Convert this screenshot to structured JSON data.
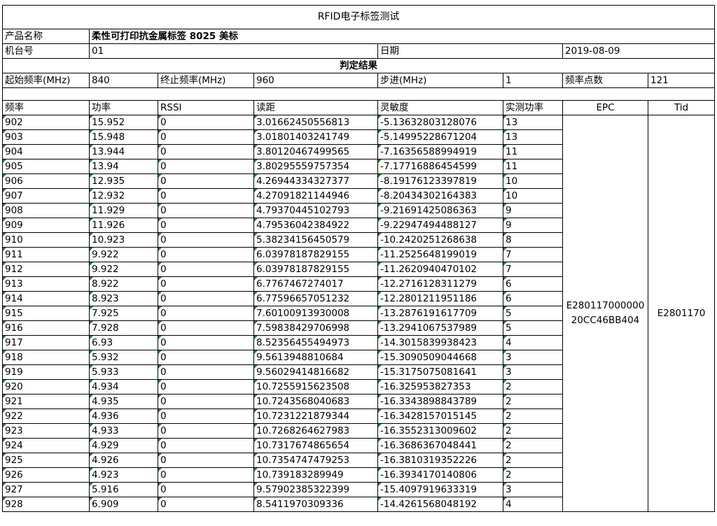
{
  "title": "RFID电子标签测试",
  "product": {
    "label": "产品名称",
    "value": "柔性可打印抗金属标签 8025 美标"
  },
  "machine": {
    "label": "机台号",
    "value": "01",
    "date_label": "日期",
    "date_value": "2019-08-09"
  },
  "judgement": "判定结果",
  "params": {
    "start_label": "起始频率(MHz)",
    "start_value": "840",
    "end_label": "终止频率(MHz)",
    "end_value": "960",
    "step_label": "步进(MHz)",
    "step_value": "1",
    "points_label": "频率点数",
    "points_value": "121"
  },
  "columns": [
    "频率",
    "功率",
    "RSSI",
    "读距",
    "灵敏度",
    "实测功率",
    "EPC",
    "Tid"
  ],
  "epc": "E280117000000 20CC46BB404",
  "tid": "E2801170",
  "rows": [
    [
      "902",
      "15.952",
      "0",
      "3.01662450556813",
      "-5.13632803128076",
      "13"
    ],
    [
      "903",
      "15.948",
      "0",
      "3.01801403241749",
      "-5.14995228671204",
      "13"
    ],
    [
      "904",
      "13.944",
      "0",
      "3.80120467499565",
      "-7.16356588994919",
      "11"
    ],
    [
      "905",
      "13.94",
      "0",
      "3.80295559757354",
      "-7.17716886454599",
      "11"
    ],
    [
      "906",
      "12.935",
      "0",
      "4.26944334327377",
      "-8.19176123397819",
      "10"
    ],
    [
      "907",
      "12.932",
      "0",
      "4.27091821144946",
      "-8.20434302164383",
      "10"
    ],
    [
      "908",
      "11.929",
      "0",
      "4.79370445102793",
      "-9.21691425086363",
      "9"
    ],
    [
      "909",
      "11.926",
      "0",
      "4.79536042384922",
      "-9.22947494488127",
      "9"
    ],
    [
      "910",
      "10.923",
      "0",
      "5.38234156450579",
      "-10.2420251268638",
      "8"
    ],
    [
      "911",
      "9.922",
      "0",
      "6.03978187829155",
      "-11.2525648199019",
      "7"
    ],
    [
      "912",
      "9.922",
      "0",
      "6.03978187829155",
      "-11.2620940470102",
      "7"
    ],
    [
      "913",
      "8.922",
      "0",
      "6.7767467274017",
      "-12.2716128311279",
      "6"
    ],
    [
      "914",
      "8.923",
      "0",
      "6.77596657051232",
      "-12.2801211951186",
      "6"
    ],
    [
      "915",
      "7.925",
      "0",
      "7.60100913930008",
      "-13.2876191617709",
      "5"
    ],
    [
      "916",
      "7.928",
      "0",
      "7.59838429706998",
      "-13.2941067537989",
      "5"
    ],
    [
      "917",
      "6.93",
      "0",
      "8.52356455494973",
      "-14.3015839938423",
      "4"
    ],
    [
      "918",
      "5.932",
      "0",
      "9.5613948810684",
      "-15.3090509044668",
      "3"
    ],
    [
      "919",
      "5.933",
      "0",
      "9.56029414816682",
      "-15.3175075081641",
      "3"
    ],
    [
      "920",
      "4.934",
      "0",
      "10.7255915623508",
      "-16.325953827353",
      "2"
    ],
    [
      "921",
      "4.935",
      "0",
      "10.7243568040683",
      "-16.3343898843789",
      "2"
    ],
    [
      "922",
      "4.936",
      "0",
      "10.7231221879344",
      "-16.3428157015145",
      "2"
    ],
    [
      "923",
      "4.933",
      "0",
      "10.7268264627983",
      "-16.3552313009602",
      "2"
    ],
    [
      "924",
      "4.929",
      "0",
      "10.7317674865654",
      "-16.3686367048441",
      "2"
    ],
    [
      "925",
      "4.926",
      "0",
      "10.7354747479253",
      "-16.3810319352226",
      "2"
    ],
    [
      "926",
      "4.923",
      "0",
      "10.739183289949",
      "-16.3934170140806",
      "2"
    ],
    [
      "927",
      "5.916",
      "0",
      "9.57902385322399",
      "-15.4097919633319",
      "3"
    ],
    [
      "928",
      "6.909",
      "0",
      "8.5411970309336",
      "-14.4261568048192",
      "4"
    ]
  ]
}
